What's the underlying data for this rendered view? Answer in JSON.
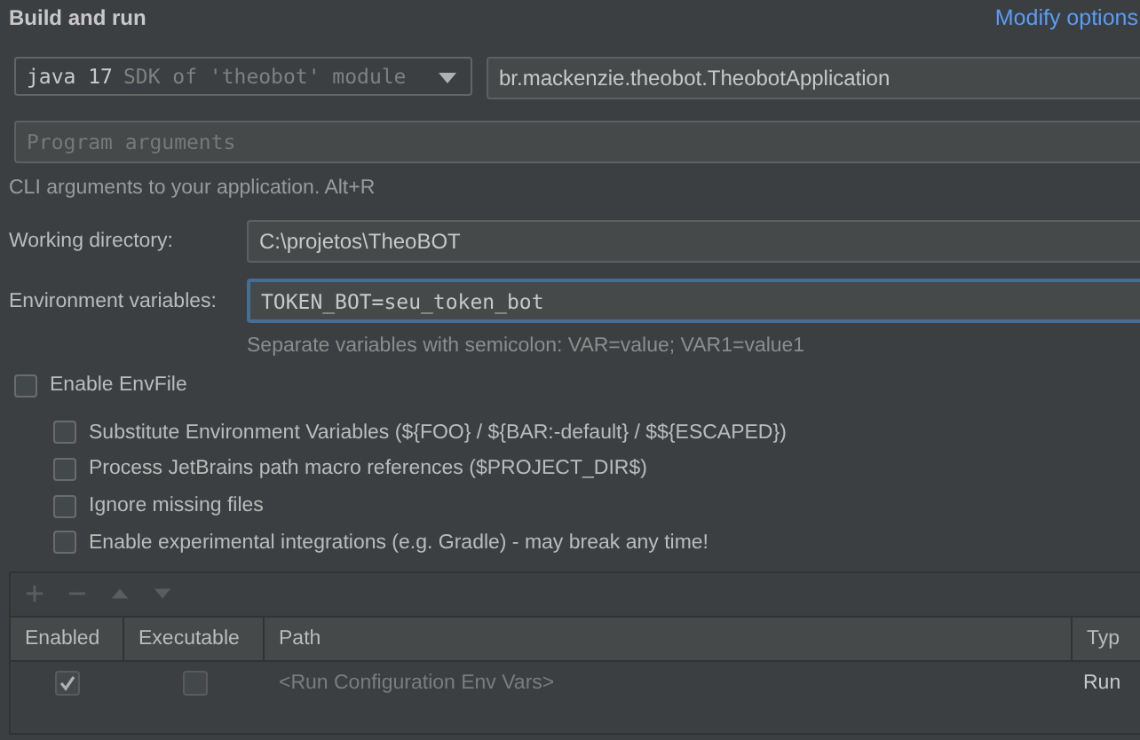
{
  "section": {
    "title": "Build and run",
    "modify_options": "Modify options"
  },
  "jre": {
    "value": "java 17",
    "hint": "SDK of 'theobot' module"
  },
  "main_class": {
    "value": "br.mackenzie.theobot.TheobotApplication"
  },
  "program_arguments": {
    "placeholder": "Program arguments",
    "hint": "CLI arguments to your application. Alt+R"
  },
  "working_directory": {
    "label": "Working directory:",
    "value": "C:\\projetos\\TheoBOT"
  },
  "environment_variables": {
    "label": "Environment variables:",
    "value": "TOKEN_BOT=seu_token_bot",
    "focused": true,
    "hint": "Separate variables with semicolon: VAR=value; VAR1=value1"
  },
  "envfile": {
    "label": "Enable EnvFile",
    "checked": false,
    "options": [
      {
        "label": "Substitute Environment Variables (${FOO} / ${BAR:-default} / $${ESCAPED})",
        "checked": false
      },
      {
        "label": "Process JetBrains path macro references ($PROJECT_DIR$)",
        "checked": false
      },
      {
        "label": "Ignore missing files",
        "checked": false
      },
      {
        "label": "Enable experimental integrations (e.g. Gradle) - may break any time!",
        "checked": false
      }
    ]
  },
  "table": {
    "toolbar": [
      {
        "kind": "add",
        "disabled": true
      },
      {
        "kind": "remove",
        "disabled": true
      },
      {
        "kind": "up",
        "disabled": true
      },
      {
        "kind": "down",
        "disabled": true
      }
    ],
    "columns": [
      "Enabled",
      "Executable",
      "Path",
      "Typ"
    ],
    "rows": [
      {
        "enabled": true,
        "executable": false,
        "disabled": true,
        "path": "<Run Configuration Env Vars>",
        "type": "Run"
      }
    ]
  }
}
